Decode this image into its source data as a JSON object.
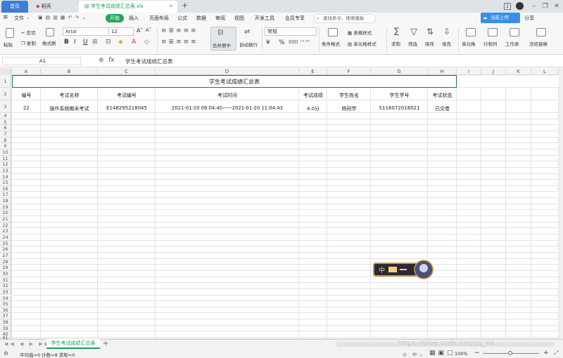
{
  "tabs": {
    "home": "首页",
    "daoke": "稻壳",
    "file": "学生考试成绩汇总表.xls",
    "new_tab": "+"
  },
  "window": {
    "counter": "1",
    "minimize": "–",
    "restore": "❐",
    "close": "✕"
  },
  "menu": {
    "file": "文件",
    "start": "开始",
    "insert": "插入",
    "layout": "页面布局",
    "formula": "公式",
    "data": "数据",
    "review": "审阅",
    "view": "视图",
    "devtools": "开发工具",
    "member": "会员专享",
    "search_placeholder": "查找命令、搜索模板",
    "cloud": "当前上传",
    "share": "分享"
  },
  "ribbon": {
    "paste": "粘贴",
    "cut": "剪切",
    "copy": "复制",
    "format_painter": "格式刷",
    "font_name": "Arial",
    "font_size": "12",
    "bold": "B",
    "italic": "I",
    "underline": "U",
    "merge_center": "合并居中",
    "wrap": "自动换行",
    "number_format": "常规",
    "currency": "¥",
    "percent": "%",
    "conditional": "条件格式",
    "table_style": "表格样式",
    "cell_style": "单元格样式",
    "sum": "求和",
    "filter": "筛选",
    "sort": "排序",
    "fill": "填充",
    "cells": "单元格",
    "row_col": "行和列",
    "worksheet": "工作表",
    "freeze": "冻结窗格"
  },
  "formula_bar": {
    "name_box": "A1",
    "fx": "fx",
    "content": "学生考试成绩汇总表"
  },
  "columns": [
    "A",
    "B",
    "C",
    "D",
    "E",
    "F",
    "G",
    "H",
    "I",
    "J",
    "K",
    "L"
  ],
  "sheet": {
    "title": "学生考试成绩汇总表",
    "headers": [
      "编号",
      "考试名称",
      "考试编号",
      "考试时间",
      "考试成绩",
      "学生姓名",
      "学生学号",
      "考试状态"
    ],
    "row": [
      "22",
      "操作系统期末考试",
      "E148295218045",
      "2021-01-20 08:04:40——2021-01-20 11:04:43",
      "4.0分",
      "杨同学",
      "S116072018021",
      "已交卷"
    ]
  },
  "sheet_tab": "学生考试成绩汇总表",
  "status": {
    "stats": "平均值=0  计数=8  求和=0",
    "zoom": "100%",
    "minus": "−",
    "plus": "+"
  },
  "watermark": "https://blog.csdn.net/qq_46"
}
